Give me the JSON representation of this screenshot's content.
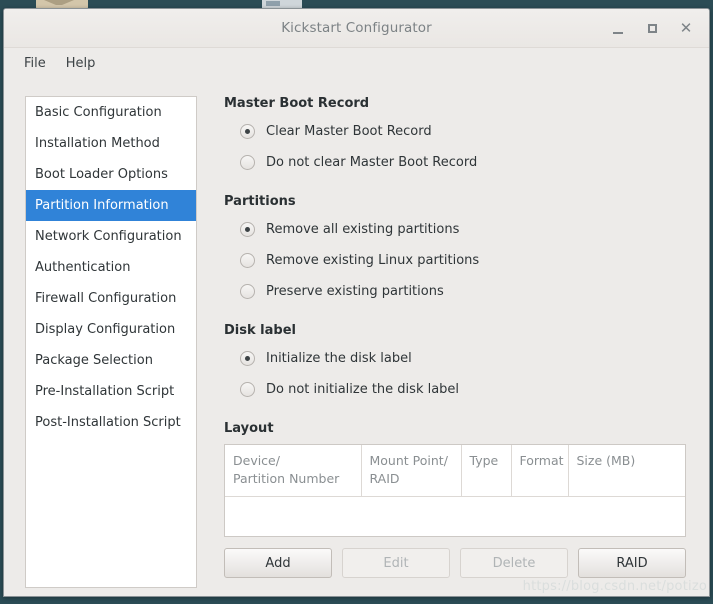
{
  "window": {
    "title": "Kickstart Configurator",
    "controls": {
      "minimize": "–",
      "maximize": "□",
      "close": "×"
    }
  },
  "menubar": {
    "items": [
      {
        "label": "File"
      },
      {
        "label": "Help"
      }
    ]
  },
  "sidebar": {
    "items": [
      {
        "label": "Basic Configuration",
        "selected": false
      },
      {
        "label": "Installation Method",
        "selected": false
      },
      {
        "label": "Boot Loader Options",
        "selected": false
      },
      {
        "label": "Partition Information",
        "selected": true
      },
      {
        "label": "Network Configuration",
        "selected": false
      },
      {
        "label": "Authentication",
        "selected": false
      },
      {
        "label": "Firewall Configuration",
        "selected": false
      },
      {
        "label": "Display Configuration",
        "selected": false
      },
      {
        "label": "Package Selection",
        "selected": false
      },
      {
        "label": "Pre-Installation Script",
        "selected": false
      },
      {
        "label": "Post-Installation Script",
        "selected": false
      }
    ],
    "selected_color": "#3083d8"
  },
  "main": {
    "mbr": {
      "title": "Master Boot Record",
      "options": [
        {
          "label": "Clear Master Boot Record",
          "checked": true
        },
        {
          "label": "Do not clear Master Boot Record",
          "checked": false
        }
      ]
    },
    "partitions": {
      "title": "Partitions",
      "options": [
        {
          "label": "Remove all existing partitions",
          "checked": true
        },
        {
          "label": "Remove existing Linux partitions",
          "checked": false
        },
        {
          "label": "Preserve existing partitions",
          "checked": false
        }
      ]
    },
    "disk_label": {
      "title": "Disk label",
      "options": [
        {
          "label": "Initialize the disk label",
          "checked": true
        },
        {
          "label": "Do not initialize the disk label",
          "checked": false
        }
      ]
    },
    "layout": {
      "title": "Layout",
      "columns": [
        "Device/\nPartition Number",
        "Mount Point/\nRAID",
        "Type",
        "Format",
        "Size (MB)"
      ],
      "rows": [],
      "buttons": [
        {
          "label": "Add",
          "enabled": true
        },
        {
          "label": "Edit",
          "enabled": false
        },
        {
          "label": "Delete",
          "enabled": false
        },
        {
          "label": "RAID",
          "enabled": true
        }
      ]
    }
  },
  "watermark": "https://blog.csdn.net/potizo"
}
